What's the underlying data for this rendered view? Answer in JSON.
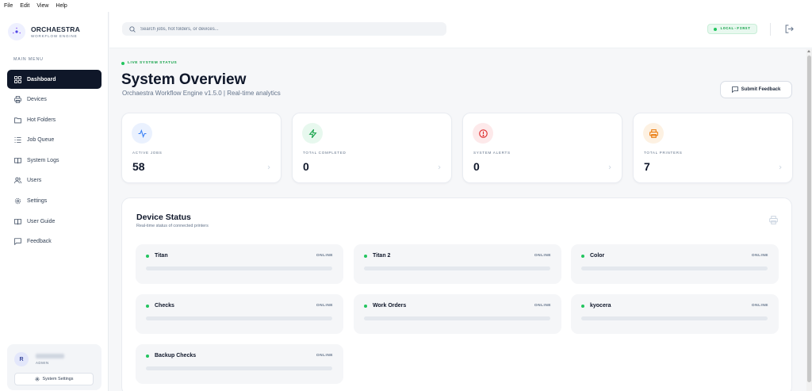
{
  "menubar": {
    "items": [
      "File",
      "Edit",
      "View",
      "Help"
    ]
  },
  "brand": {
    "title": "ORCHAESTRA",
    "subtitle": "WORKFLOW ENGINE"
  },
  "sidebar": {
    "heading": "MAIN MENU",
    "items": [
      {
        "label": "Dashboard",
        "icon": "dashboard-icon",
        "active": true
      },
      {
        "label": "Devices",
        "icon": "printer-icon"
      },
      {
        "label": "Hot Folders",
        "icon": "folder-icon"
      },
      {
        "label": "Job Queue",
        "icon": "list-icon"
      },
      {
        "label": "System Logs",
        "icon": "book-icon"
      },
      {
        "label": "Users",
        "icon": "users-icon"
      },
      {
        "label": "Settings",
        "icon": "gear-icon"
      },
      {
        "label": "User Guide",
        "icon": "book-icon"
      },
      {
        "label": "Feedback",
        "icon": "message-icon"
      }
    ],
    "user": {
      "initial": "R",
      "role": "ADMIN",
      "settings_label": "System Settings"
    }
  },
  "topbar": {
    "search_placeholder": "Search jobs, hot folders, or devices...",
    "mode_badge": "LOCAL-FIRST"
  },
  "main": {
    "live_label": "LIVE SYSTEM STATUS",
    "title": "System Overview",
    "subtitle": "Orchaestra Workflow Engine v1.5.0 | Real-time analytics",
    "feedback_button": "Submit Feedback",
    "stats": [
      {
        "label": "ACTIVE JOBS",
        "value": "58",
        "icon": "activity-icon",
        "color": "#3b82f6",
        "bg": "#eaf1fe"
      },
      {
        "label": "TOTAL COMPLETED",
        "value": "0",
        "icon": "lightning-icon",
        "color": "#16a34a",
        "bg": "#e7f8ee"
      },
      {
        "label": "SYSTEM ALERTS",
        "value": "0",
        "icon": "alert-icon",
        "color": "#dc2626",
        "bg": "#fde9ea"
      },
      {
        "label": "TOTAL PRINTERS",
        "value": "7",
        "icon": "printer-icon",
        "color": "#ea7a0c",
        "bg": "#fdf1e2"
      }
    ],
    "device_status": {
      "title": "Device Status",
      "subtitle": "Real-time status of connected printers",
      "devices": [
        {
          "name": "Titan",
          "status": "ONLINE"
        },
        {
          "name": "Titan 2",
          "status": "ONLINE"
        },
        {
          "name": "Color",
          "status": "ONLINE"
        },
        {
          "name": "Checks",
          "status": "ONLINE"
        },
        {
          "name": "Work Orders",
          "status": "ONLINE"
        },
        {
          "name": "kyocera",
          "status": "ONLINE"
        },
        {
          "name": "Backup Checks",
          "status": "ONLINE"
        }
      ]
    }
  },
  "colors": {
    "accent_dark": "#0f1729",
    "online": "#22c55e"
  }
}
